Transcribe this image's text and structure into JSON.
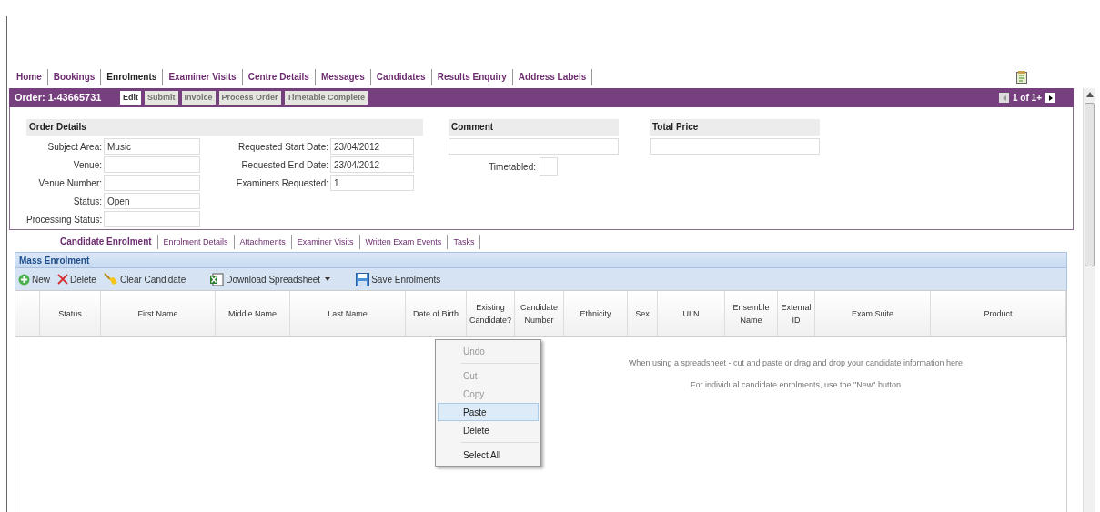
{
  "nav": [
    {
      "label": "Home",
      "selected": false
    },
    {
      "label": "Bookings",
      "selected": false
    },
    {
      "label": "Enrolments",
      "selected": true
    },
    {
      "label": "Examiner Visits",
      "selected": false
    },
    {
      "label": "Centre Details",
      "selected": false
    },
    {
      "label": "Messages",
      "selected": false
    },
    {
      "label": "Candidates",
      "selected": false
    },
    {
      "label": "Results Enquiry",
      "selected": false
    },
    {
      "label": "Address Labels",
      "selected": false
    }
  ],
  "order_bar": {
    "title": "Order: 1-43665731",
    "buttons": [
      {
        "label": "Edit",
        "disabled": false
      },
      {
        "label": "Submit",
        "disabled": true
      },
      {
        "label": "Invoice",
        "disabled": true
      },
      {
        "label": "Process Order",
        "disabled": true
      },
      {
        "label": "Timetable Complete",
        "disabled": true
      }
    ],
    "pager": "1 of 1+"
  },
  "order_details": {
    "title": "Order Details",
    "left_fields": [
      {
        "label": "Subject Area:",
        "value": "Music"
      },
      {
        "label": "Venue:"
      },
      {
        "label": "Venue Number:"
      },
      {
        "label": "Status:",
        "value": "Open"
      },
      {
        "label": "Processing Status:"
      }
    ],
    "right_fields": [
      {
        "label": "Requested Start Date:",
        "value": "23/04/2012"
      },
      {
        "label": "Requested End Date:",
        "value": "23/04/2012"
      },
      {
        "label": "Examiners Requested:",
        "value": "1"
      }
    ]
  },
  "comment": {
    "title": "Comment",
    "timetabled_label": "Timetabled:"
  },
  "total_price": {
    "title": "Total Price"
  },
  "sub_tabs": [
    {
      "label": "Candidate Enrolment",
      "selected": true
    },
    {
      "label": "Enrolment Details",
      "selected": false
    },
    {
      "label": "Attachments",
      "selected": false
    },
    {
      "label": "Examiner Visits",
      "selected": false
    },
    {
      "label": "Written Exam Events",
      "selected": false
    },
    {
      "label": "Tasks",
      "selected": false
    }
  ],
  "mass_enrolment": {
    "title": "Mass Enrolment",
    "toolbar": [
      {
        "kind": "new",
        "label": "New"
      },
      {
        "kind": "delete",
        "label": "Delete"
      },
      {
        "kind": "clear",
        "label": "Clear Candidate"
      },
      {
        "kind": "download",
        "label": "Download Spreadsheet"
      },
      {
        "kind": "save",
        "label": "Save Enrolments"
      }
    ],
    "columns": [
      "",
      "Status",
      "First Name",
      "Middle Name",
      "Last Name",
      "Date of Birth",
      "Existing Candidate?",
      "Candidate Number",
      "Ethnicity",
      "Sex",
      "ULN",
      "Ensemble Name",
      "External ID",
      "Exam Suite",
      "Product"
    ],
    "messages": [
      "When using a spreadsheet - cut and paste or drag and drop your candidate information here",
      "For individual candidate enrolments, use the \"New\" button"
    ]
  },
  "context_menu": [
    {
      "label": "Undo",
      "disabled": true,
      "selected": false,
      "separator_after": true
    },
    {
      "label": "Cut",
      "disabled": true,
      "selected": false,
      "separator_after": false
    },
    {
      "label": "Copy",
      "disabled": true,
      "selected": false,
      "separator_after": false
    },
    {
      "label": "Paste",
      "disabled": false,
      "selected": true,
      "separator_after": false
    },
    {
      "label": "Delete",
      "disabled": false,
      "selected": false,
      "separator_after": true
    },
    {
      "label": "Select All",
      "disabled": false,
      "selected": false,
      "separator_after": false
    }
  ]
}
